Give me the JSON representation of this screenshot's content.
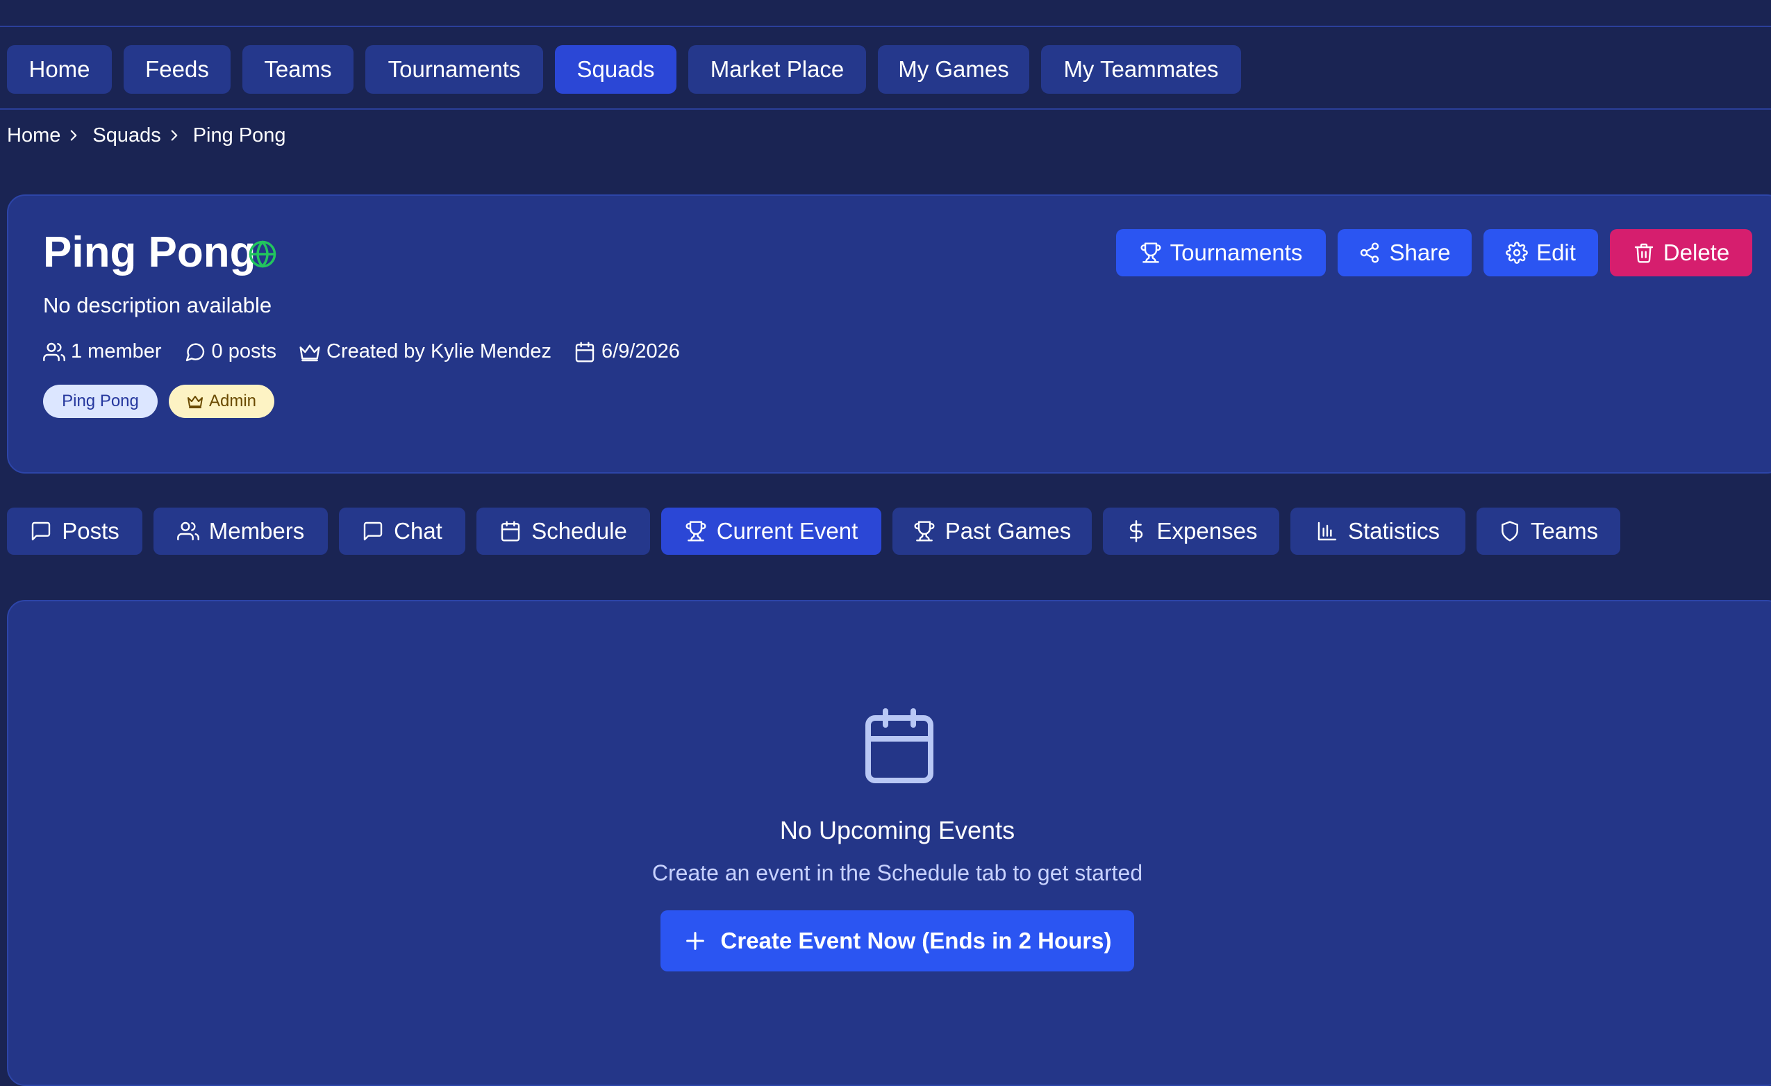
{
  "nav": {
    "items": [
      {
        "label": "Home"
      },
      {
        "label": "Feeds"
      },
      {
        "label": "Teams"
      },
      {
        "label": "Tournaments"
      },
      {
        "label": "Squads",
        "active": true
      },
      {
        "label": "Market Place"
      },
      {
        "label": "My Games"
      },
      {
        "label": "My Teammates"
      }
    ]
  },
  "breadcrumb": [
    "Home",
    "Squads",
    "Ping Pong"
  ],
  "squad": {
    "title": "Ping Pong",
    "description": "No description available",
    "members": "1 member",
    "posts": "0 posts",
    "created_by": "Created by Kylie Mendez",
    "date": "6/9/2026",
    "tags": {
      "sport": "Ping Pong",
      "role": "Admin"
    }
  },
  "actions": {
    "tournaments": "Tournaments",
    "share": "Share",
    "edit": "Edit",
    "delete": "Delete"
  },
  "tabs": [
    {
      "label": "Posts",
      "icon": "message-icon"
    },
    {
      "label": "Members",
      "icon": "users-icon"
    },
    {
      "label": "Chat",
      "icon": "chat-icon"
    },
    {
      "label": "Schedule",
      "icon": "calendar-icon"
    },
    {
      "label": "Current Event",
      "icon": "trophy-icon",
      "active": true
    },
    {
      "label": "Past Games",
      "icon": "trophy-icon"
    },
    {
      "label": "Expenses",
      "icon": "dollar-icon"
    },
    {
      "label": "Statistics",
      "icon": "bar-chart-icon"
    },
    {
      "label": "Teams",
      "icon": "shield-icon"
    }
  ],
  "empty_state": {
    "title": "No Upcoming Events",
    "subtitle": "Create an event in the Schedule tab to get started",
    "button": "Create Event Now (Ends in 2 Hours)"
  },
  "colors": {
    "background": "#1a2453",
    "card": "#243688",
    "accent": "#2b55f2",
    "delete": "#d61e6e",
    "globe": "#22c55e"
  }
}
